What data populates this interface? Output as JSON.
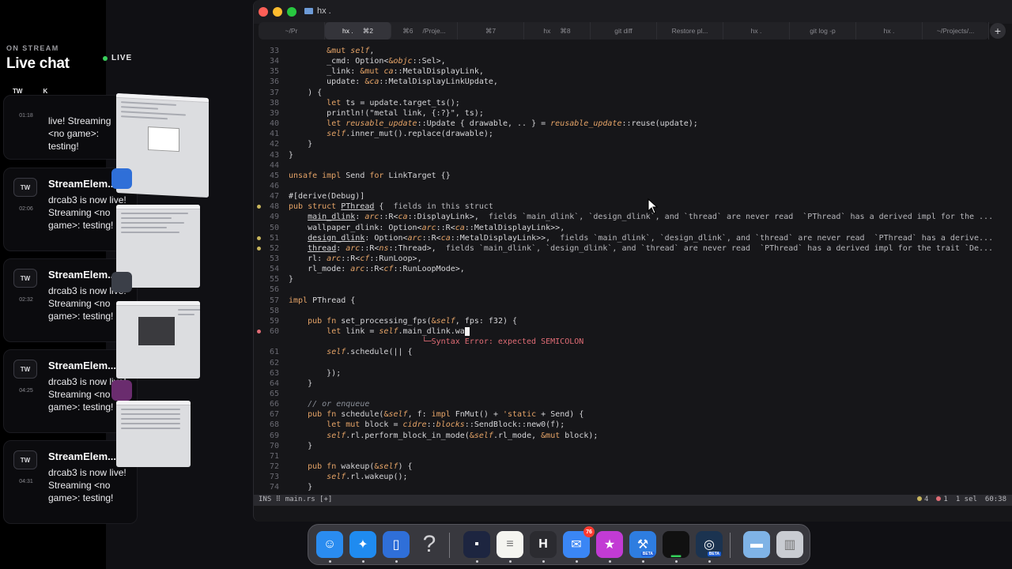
{
  "chat": {
    "eyebrow": "ON STREAM",
    "title": "Live chat",
    "live_label": "LIVE",
    "tabs": [
      "TW",
      "K"
    ],
    "first_partial": {
      "time": "01:18",
      "body": "live! Streaming <no game>: testing!"
    },
    "messages": [
      {
        "avatar": "TW",
        "time": "02:06",
        "author": "StreamElem...",
        "body": "drcab3 is now live! Streaming <no game>: testing!"
      },
      {
        "avatar": "TW",
        "time": "02:32",
        "author": "StreamElem...",
        "body": "drcab3 is now live! Streaming <no game>: testing!"
      },
      {
        "avatar": "TW",
        "time": "04:25",
        "author": "StreamElem...",
        "body": "drcab3 is now live! Streaming <no game>: testing!"
      },
      {
        "avatar": "TW",
        "time": "04:31",
        "author": "StreamElem...",
        "body": "drcab3 is now live! Streaming <no game>: testing!"
      }
    ]
  },
  "window": {
    "title": "hx .",
    "tabs": [
      {
        "label": "~/Pr",
        "kbd": ""
      },
      {
        "label": "hx .",
        "kbd": "⌘2",
        "active": true
      },
      {
        "label": "⌘6",
        "kbd": "/Proje..."
      },
      {
        "label": "⌘7",
        "kbd": ""
      },
      {
        "label": "hx",
        "kbd": "⌘8"
      },
      {
        "label": "git diff",
        "kbd": ""
      },
      {
        "label": "Restore pl...",
        "kbd": ""
      },
      {
        "label": "hx .",
        "kbd": ""
      },
      {
        "label": "git log -p",
        "kbd": ""
      },
      {
        "label": "hx .",
        "kbd": ""
      },
      {
        "label": "~/Projects/...",
        "kbd": ""
      }
    ],
    "new_tab": "+"
  },
  "code_lines": [
    {
      "n": "33",
      "html": "        <span class='k'>&amp;mut</span> <span class='i'>self</span>,"
    },
    {
      "n": "34",
      "html": "        _cmd: Option&lt;<span class='k'>&amp;</span><span class='i'>objc</span>::Sel&gt;,"
    },
    {
      "n": "35",
      "html": "        _link: <span class='k'>&amp;mut</span> <span class='i'>ca</span>::MetalDisplayLink,"
    },
    {
      "n": "36",
      "html": "        update: <span class='k'>&amp;</span><span class='i'>ca</span>::MetalDisplayLinkUpdate,"
    },
    {
      "n": "37",
      "html": "    ) {"
    },
    {
      "n": "38",
      "html": "        <span class='k'>let</span> ts = update.target_ts();"
    },
    {
      "n": "39",
      "html": "        println!(\"metal link, {:?}\", ts);"
    },
    {
      "n": "40",
      "html": "        <span class='k'>let</span> <span class='i'>reusable_update</span>::Update { drawable, .. } = <span class='i'>reusable_update</span>::reuse(update);"
    },
    {
      "n": "41",
      "html": "        <span class='i'>self</span>.inner_mut().replace(drawable);"
    },
    {
      "n": "42",
      "html": "    }"
    },
    {
      "n": "43",
      "html": "}"
    },
    {
      "n": "44",
      "html": ""
    },
    {
      "n": "45",
      "html": "<span class='k'>unsafe impl</span> Send <span class='k'>for</span> LinkTarget {}"
    },
    {
      "n": "46",
      "html": ""
    },
    {
      "n": "47",
      "html": "#[derive(Debug)]"
    },
    {
      "n": "48",
      "gut": "warn",
      "html": "<span class='k'>pub struct</span> <u>PThread</u> {  <span class='hint'>fields in this struct</span>"
    },
    {
      "n": "49",
      "html": "    <u>main_dlink</u>: <span class='i'>arc</span>::R&lt;<span class='i'>ca</span>::DisplayLink&gt;,  <span class='hint'>fields `main_dlink`, `design_dlink`, and `thread` are never read  `PThread` has a derived impl for the ...</span>"
    },
    {
      "n": "50",
      "html": "    wallpaper_dlink: Option&lt;<span class='i'>arc</span>::R&lt;<span class='i'>ca</span>::MetalDisplayLink&gt;&gt;,"
    },
    {
      "n": "51",
      "gut": "warn",
      "html": "    <u>design_dlink</u>: Option&lt;<span class='i'>arc</span>::R&lt;<span class='i'>ca</span>::MetalDisplayLink&gt;&gt;,  <span class='hint'>fields `main_dlink`, `design_dlink`, and `thread` are never read  `PThread` has a derive...</span>"
    },
    {
      "n": "52",
      "gut": "warn",
      "html": "    <u>thread</u>: <span class='i'>arc</span>::R&lt;<span class='i'>ns</span>::Thread&gt;,  <span class='hint'>fields `main_dlink`, `design_dlink`, and `thread` are never read  `PThread` has a derived impl for the trait `De...</span>"
    },
    {
      "n": "53",
      "html": "    rl: <span class='i'>arc</span>::R&lt;<span class='i'>cf</span>::RunLoop&gt;,"
    },
    {
      "n": "54",
      "html": "    rl_mode: <span class='i'>arc</span>::R&lt;<span class='i'>cf</span>::RunLoopMode&gt;,"
    },
    {
      "n": "55",
      "html": "}"
    },
    {
      "n": "56",
      "html": ""
    },
    {
      "n": "57",
      "html": "<span class='k'>impl</span> PThread {"
    },
    {
      "n": "58",
      "html": ""
    },
    {
      "n": "59",
      "html": "    <span class='k'>pub fn</span> set_processing_fps(<span class='k'>&amp;</span><span class='i'>self</span>, fps: f32) {"
    },
    {
      "n": "60",
      "gut": "err",
      "html": "        <span class='k'>let</span> link = <span class='i'>self</span>.main_dlink.wa<span class='cursor'> </span>"
    },
    {
      "n": "",
      "html": "                            <span class='errtxt'>└─Syntax Error: expected SEMICOLON</span>"
    },
    {
      "n": "61",
      "html": "        <span class='i'>self</span>.schedule(|| {"
    },
    {
      "n": "62",
      "html": ""
    },
    {
      "n": "63",
      "html": "        });"
    },
    {
      "n": "64",
      "html": "    }"
    },
    {
      "n": "65",
      "html": ""
    },
    {
      "n": "66",
      "html": "    <span class='c'>// or enqueue</span>"
    },
    {
      "n": "67",
      "html": "    <span class='k'>pub fn</span> schedule(<span class='k'>&amp;</span><span class='i'>self</span>, f: <span class='k'>impl</span> FnMut() + <span class='k'>'static</span> + Send) {"
    },
    {
      "n": "68",
      "html": "        <span class='k'>let mut</span> block = <span class='i'>cidre</span>::<span class='i'>blocks</span>::SendBlock::new0(f);"
    },
    {
      "n": "69",
      "html": "        <span class='i'>self</span>.rl.perform_block_in_mode(<span class='k'>&amp;</span><span class='i'>self</span>.rl_mode, <span class='k'>&amp;mut</span> block);"
    },
    {
      "n": "70",
      "html": "    }"
    },
    {
      "n": "71",
      "html": ""
    },
    {
      "n": "72",
      "html": "    <span class='k'>pub fn</span> wakeup(<span class='k'>&amp;</span><span class='i'>self</span>) {"
    },
    {
      "n": "73",
      "html": "        <span class='i'>self</span>.rl.wakeup();"
    },
    {
      "n": "74",
      "html": "    }"
    }
  ],
  "status": {
    "mode": "INS",
    "file": "main.rs [+]",
    "warnings": "4",
    "errors": "1",
    "selection": "1 sel",
    "position": "60:38",
    "warn_color": "#c9b65d",
    "error_color": "#e06c75"
  },
  "dock": {
    "items": [
      {
        "name": "finder-icon",
        "color": "#2a8cf0",
        "glyph": "☺"
      },
      {
        "name": "safari-icon",
        "color": "#1f8bf0",
        "glyph": "✦"
      },
      {
        "name": "simulator-icon",
        "color": "#2f6fd8",
        "glyph": "▯"
      },
      {
        "name": "help-icon",
        "color": "transparent",
        "glyph": "?"
      },
      {
        "name": "screen-app-icon",
        "color": "#1d2540",
        "glyph": "▪"
      },
      {
        "name": "notes-icon",
        "color": "#f5f5f0",
        "glyph": "≡"
      },
      {
        "name": "helix-icon",
        "color": "#2b2b30",
        "glyph": "H"
      },
      {
        "name": "mail-icon",
        "color": "#3a86f5",
        "glyph": "✉",
        "badge": "76"
      },
      {
        "name": "star-app-icon",
        "color": "#c23bd4",
        "glyph": "★"
      },
      {
        "name": "xcode-beta-icon",
        "color": "#2e7de0",
        "glyph": "⚒",
        "beta": "BETA"
      },
      {
        "name": "activity-monitor-icon",
        "color": "#111",
        "glyph": "▁"
      },
      {
        "name": "instruments-beta-icon",
        "color": "#1b3350",
        "glyph": "◎",
        "beta": "BETA"
      },
      {
        "name": "folder-icon",
        "color": "#7fb3e6",
        "glyph": "▬"
      },
      {
        "name": "trash-icon",
        "color": "#c9ccd2",
        "glyph": "▥"
      }
    ]
  }
}
